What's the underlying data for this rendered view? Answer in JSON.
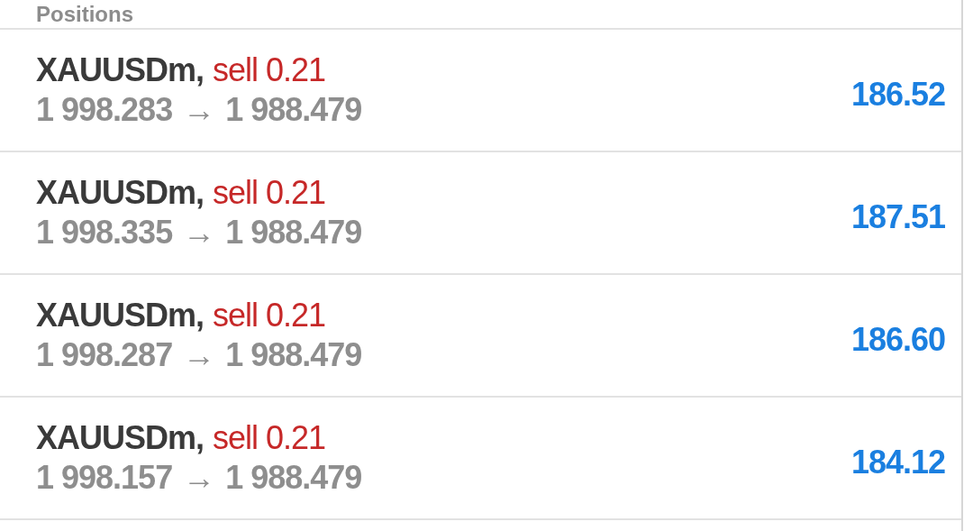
{
  "header": {
    "title": "Positions"
  },
  "positions": [
    {
      "symbol": "XAUUSDm,",
      "kind": "sell",
      "type_label": "sell 0.21",
      "open_price": "1 998.283",
      "arrow": "→",
      "current_price": "1 988.479",
      "profit": "186.52"
    },
    {
      "symbol": "XAUUSDm,",
      "kind": "sell",
      "type_label": "sell 0.21",
      "open_price": "1 998.335",
      "arrow": "→",
      "current_price": "1 988.479",
      "profit": "187.51"
    },
    {
      "symbol": "XAUUSDm,",
      "kind": "sell",
      "type_label": "sell 0.21",
      "open_price": "1 998.287",
      "arrow": "→",
      "current_price": "1 988.479",
      "profit": "186.60"
    },
    {
      "symbol": "XAUUSDm,",
      "kind": "sell",
      "type_label": "sell 0.21",
      "open_price": "1 998.157",
      "arrow": "→",
      "current_price": "1 988.479",
      "profit": "184.12"
    }
  ]
}
